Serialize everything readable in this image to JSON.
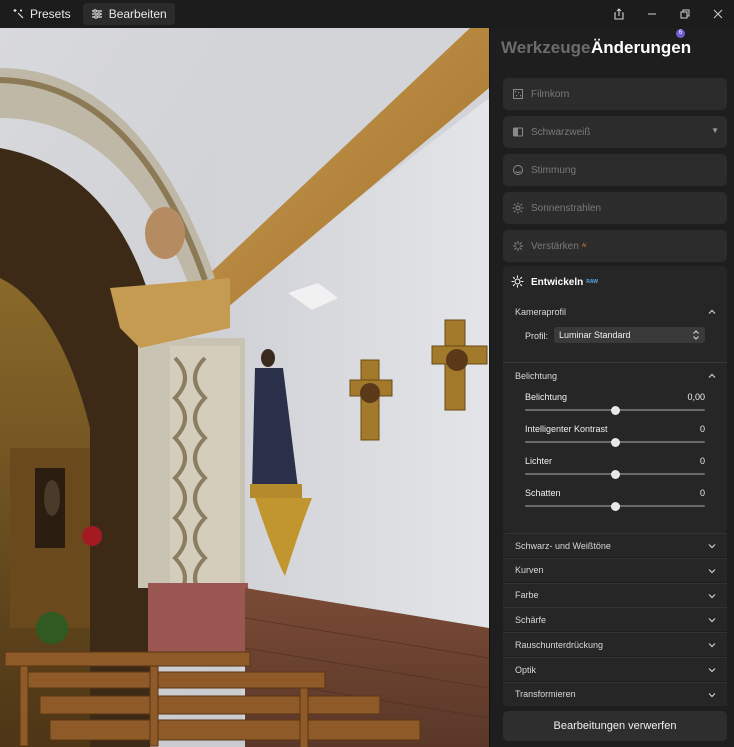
{
  "titlebar": {
    "presets_label": "Presets",
    "edit_label": "Bearbeiten"
  },
  "panel": {
    "tab_tools": "Werkzeuge",
    "tab_changes": "Änderungen",
    "changes_count": "6",
    "tools": [
      {
        "label": "Filmkorn",
        "icon": "film-grain-icon"
      },
      {
        "label": "Schwarzweiß",
        "icon": "black-white-icon"
      },
      {
        "label": "Stimmung",
        "icon": "mood-icon"
      },
      {
        "label": "Sonnenstrahlen",
        "icon": "sun-rays-icon"
      },
      {
        "label": "Verstärken",
        "icon": "enhance-icon",
        "superscript": "AI"
      }
    ],
    "develop": {
      "title": "Entwickeln",
      "tag": "RAW",
      "camera_profile": {
        "title": "Kameraprofil",
        "profile_label": "Profil:",
        "profile_value": "Luminar Standard"
      },
      "exposure": {
        "title": "Belichtung",
        "sliders": [
          {
            "label": "Belichtung",
            "value": "0,00",
            "position": 0.5
          },
          {
            "label": "Intelligenter Kontrast",
            "value": "0",
            "position": 0.5
          },
          {
            "label": "Lichter",
            "value": "0",
            "position": 0.5
          },
          {
            "label": "Schatten",
            "value": "0",
            "position": 0.5
          }
        ]
      }
    },
    "sections": [
      "Schwarz- und Weißtöne",
      "Kurven",
      "Farbe",
      "Schärfe",
      "Rauschunterdrückung",
      "Optik",
      "Transformieren"
    ],
    "discard_label": "Bearbeitungen verwerfen"
  },
  "colors": {
    "accent_badge": "#6f5bd6",
    "raw_tag": "#5fa8e8",
    "panel_bg": "#1e1e1e"
  }
}
